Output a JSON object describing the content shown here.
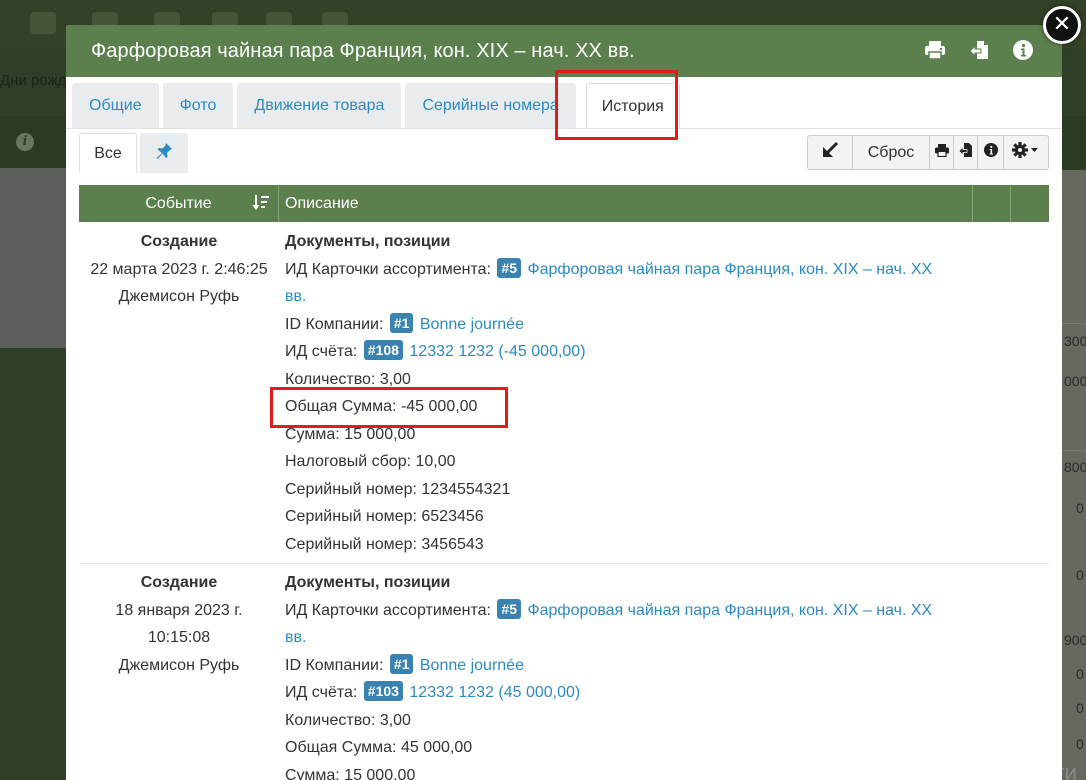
{
  "background": {
    "birthdays_label": "Дни рожд",
    "info_glyph": "i",
    "right_values": [
      "300",
      "000",
      "800",
      "0",
      "0",
      "900",
      "0",
      "0",
      "0"
    ],
    "watermark": "Акти"
  },
  "dialog": {
    "title": "Фарфоровая чайная пара Франция, кон. XIX – нач. XX вв.",
    "header_icons": [
      "print-icon",
      "export-icon",
      "info-icon"
    ],
    "close_glyph": "✕"
  },
  "tabs": [
    "Общие",
    "Фото",
    "Движение товара",
    "Серийные номера",
    "История"
  ],
  "active_tab": "История",
  "subtabs": {
    "all_label": "Все",
    "pin_icon": "pin-icon"
  },
  "toolbar": {
    "reset_label": "Сброс"
  },
  "table": {
    "headers": {
      "event": "Событие",
      "description": "Описание"
    },
    "rows": [
      {
        "event_type": "Создание",
        "date_line1": "22 марта 2023 г. 2:46:25",
        "date_line2": "",
        "user": "Джемисон Руфь",
        "section": "Документы, позиции",
        "card_label": "ИД Карточки ассортимента:",
        "card_badge": "#5",
        "card_name_line1": "Фарфоровая чайная пара Франция, кон. XIX – нач. XX",
        "card_name_line2": "вв.",
        "company_label": "ID Компании:",
        "company_badge": "#1",
        "company_name": "Bonne journée",
        "account_label": "ИД счёта:",
        "account_badge": "#108",
        "account_name": "12332 1232 (-45 000,00)",
        "quantity": "Количество: 3,00",
        "total": "Общая Сумма: -45 000,00",
        "sum": "Сумма: 15 000,00",
        "tax": "Налоговый сбор: 10,00",
        "serial1": "Серийный номер: 1234554321",
        "serial2": "Серийный номер: 6523456",
        "serial3": "Серийный номер: 3456543"
      },
      {
        "event_type": "Создание",
        "date_line1": "18 января 2023 г.",
        "date_line2": "10:15:08",
        "user": "Джемисон Руфь",
        "section": "Документы, позиции",
        "card_label": "ИД Карточки ассортимента:",
        "card_badge": "#5",
        "card_name_line1": "Фарфоровая чайная пара Франция, кон. XIX – нач. XX",
        "card_name_line2": "вв.",
        "company_label": "ID Компании:",
        "company_badge": "#1",
        "company_name": "Bonne journée",
        "account_label": "ИД счёта:",
        "account_badge": "#103",
        "account_name": "12332 1232 (45 000,00)",
        "quantity": "Количество: 3,00",
        "total": "Общая Сумма: 45 000,00",
        "sum": "Сумма: 15 000,00"
      }
    ]
  },
  "colors": {
    "header_green": "#5b7f4d",
    "link_blue": "#2b8ac2",
    "badge_blue": "#3a83b0",
    "highlight_red": "#e41b1b"
  }
}
